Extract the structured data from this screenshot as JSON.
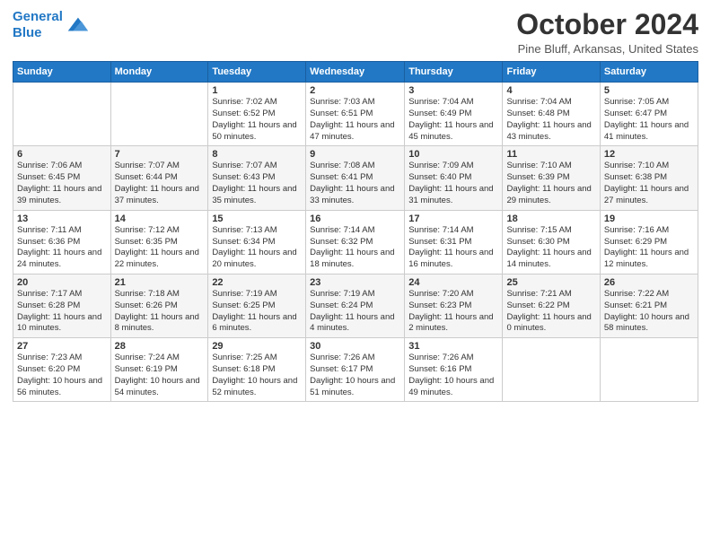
{
  "header": {
    "logo_line1": "General",
    "logo_line2": "Blue",
    "title": "October 2024",
    "subtitle": "Pine Bluff, Arkansas, United States"
  },
  "days_of_week": [
    "Sunday",
    "Monday",
    "Tuesday",
    "Wednesday",
    "Thursday",
    "Friday",
    "Saturday"
  ],
  "weeks": [
    [
      {
        "day": "",
        "info": ""
      },
      {
        "day": "",
        "info": ""
      },
      {
        "day": "1",
        "info": "Sunrise: 7:02 AM\nSunset: 6:52 PM\nDaylight: 11 hours and 50 minutes."
      },
      {
        "day": "2",
        "info": "Sunrise: 7:03 AM\nSunset: 6:51 PM\nDaylight: 11 hours and 47 minutes."
      },
      {
        "day": "3",
        "info": "Sunrise: 7:04 AM\nSunset: 6:49 PM\nDaylight: 11 hours and 45 minutes."
      },
      {
        "day": "4",
        "info": "Sunrise: 7:04 AM\nSunset: 6:48 PM\nDaylight: 11 hours and 43 minutes."
      },
      {
        "day": "5",
        "info": "Sunrise: 7:05 AM\nSunset: 6:47 PM\nDaylight: 11 hours and 41 minutes."
      }
    ],
    [
      {
        "day": "6",
        "info": "Sunrise: 7:06 AM\nSunset: 6:45 PM\nDaylight: 11 hours and 39 minutes."
      },
      {
        "day": "7",
        "info": "Sunrise: 7:07 AM\nSunset: 6:44 PM\nDaylight: 11 hours and 37 minutes."
      },
      {
        "day": "8",
        "info": "Sunrise: 7:07 AM\nSunset: 6:43 PM\nDaylight: 11 hours and 35 minutes."
      },
      {
        "day": "9",
        "info": "Sunrise: 7:08 AM\nSunset: 6:41 PM\nDaylight: 11 hours and 33 minutes."
      },
      {
        "day": "10",
        "info": "Sunrise: 7:09 AM\nSunset: 6:40 PM\nDaylight: 11 hours and 31 minutes."
      },
      {
        "day": "11",
        "info": "Sunrise: 7:10 AM\nSunset: 6:39 PM\nDaylight: 11 hours and 29 minutes."
      },
      {
        "day": "12",
        "info": "Sunrise: 7:10 AM\nSunset: 6:38 PM\nDaylight: 11 hours and 27 minutes."
      }
    ],
    [
      {
        "day": "13",
        "info": "Sunrise: 7:11 AM\nSunset: 6:36 PM\nDaylight: 11 hours and 24 minutes."
      },
      {
        "day": "14",
        "info": "Sunrise: 7:12 AM\nSunset: 6:35 PM\nDaylight: 11 hours and 22 minutes."
      },
      {
        "day": "15",
        "info": "Sunrise: 7:13 AM\nSunset: 6:34 PM\nDaylight: 11 hours and 20 minutes."
      },
      {
        "day": "16",
        "info": "Sunrise: 7:14 AM\nSunset: 6:32 PM\nDaylight: 11 hours and 18 minutes."
      },
      {
        "day": "17",
        "info": "Sunrise: 7:14 AM\nSunset: 6:31 PM\nDaylight: 11 hours and 16 minutes."
      },
      {
        "day": "18",
        "info": "Sunrise: 7:15 AM\nSunset: 6:30 PM\nDaylight: 11 hours and 14 minutes."
      },
      {
        "day": "19",
        "info": "Sunrise: 7:16 AM\nSunset: 6:29 PM\nDaylight: 11 hours and 12 minutes."
      }
    ],
    [
      {
        "day": "20",
        "info": "Sunrise: 7:17 AM\nSunset: 6:28 PM\nDaylight: 11 hours and 10 minutes."
      },
      {
        "day": "21",
        "info": "Sunrise: 7:18 AM\nSunset: 6:26 PM\nDaylight: 11 hours and 8 minutes."
      },
      {
        "day": "22",
        "info": "Sunrise: 7:19 AM\nSunset: 6:25 PM\nDaylight: 11 hours and 6 minutes."
      },
      {
        "day": "23",
        "info": "Sunrise: 7:19 AM\nSunset: 6:24 PM\nDaylight: 11 hours and 4 minutes."
      },
      {
        "day": "24",
        "info": "Sunrise: 7:20 AM\nSunset: 6:23 PM\nDaylight: 11 hours and 2 minutes."
      },
      {
        "day": "25",
        "info": "Sunrise: 7:21 AM\nSunset: 6:22 PM\nDaylight: 11 hours and 0 minutes."
      },
      {
        "day": "26",
        "info": "Sunrise: 7:22 AM\nSunset: 6:21 PM\nDaylight: 10 hours and 58 minutes."
      }
    ],
    [
      {
        "day": "27",
        "info": "Sunrise: 7:23 AM\nSunset: 6:20 PM\nDaylight: 10 hours and 56 minutes."
      },
      {
        "day": "28",
        "info": "Sunrise: 7:24 AM\nSunset: 6:19 PM\nDaylight: 10 hours and 54 minutes."
      },
      {
        "day": "29",
        "info": "Sunrise: 7:25 AM\nSunset: 6:18 PM\nDaylight: 10 hours and 52 minutes."
      },
      {
        "day": "30",
        "info": "Sunrise: 7:26 AM\nSunset: 6:17 PM\nDaylight: 10 hours and 51 minutes."
      },
      {
        "day": "31",
        "info": "Sunrise: 7:26 AM\nSunset: 6:16 PM\nDaylight: 10 hours and 49 minutes."
      },
      {
        "day": "",
        "info": ""
      },
      {
        "day": "",
        "info": ""
      }
    ]
  ]
}
